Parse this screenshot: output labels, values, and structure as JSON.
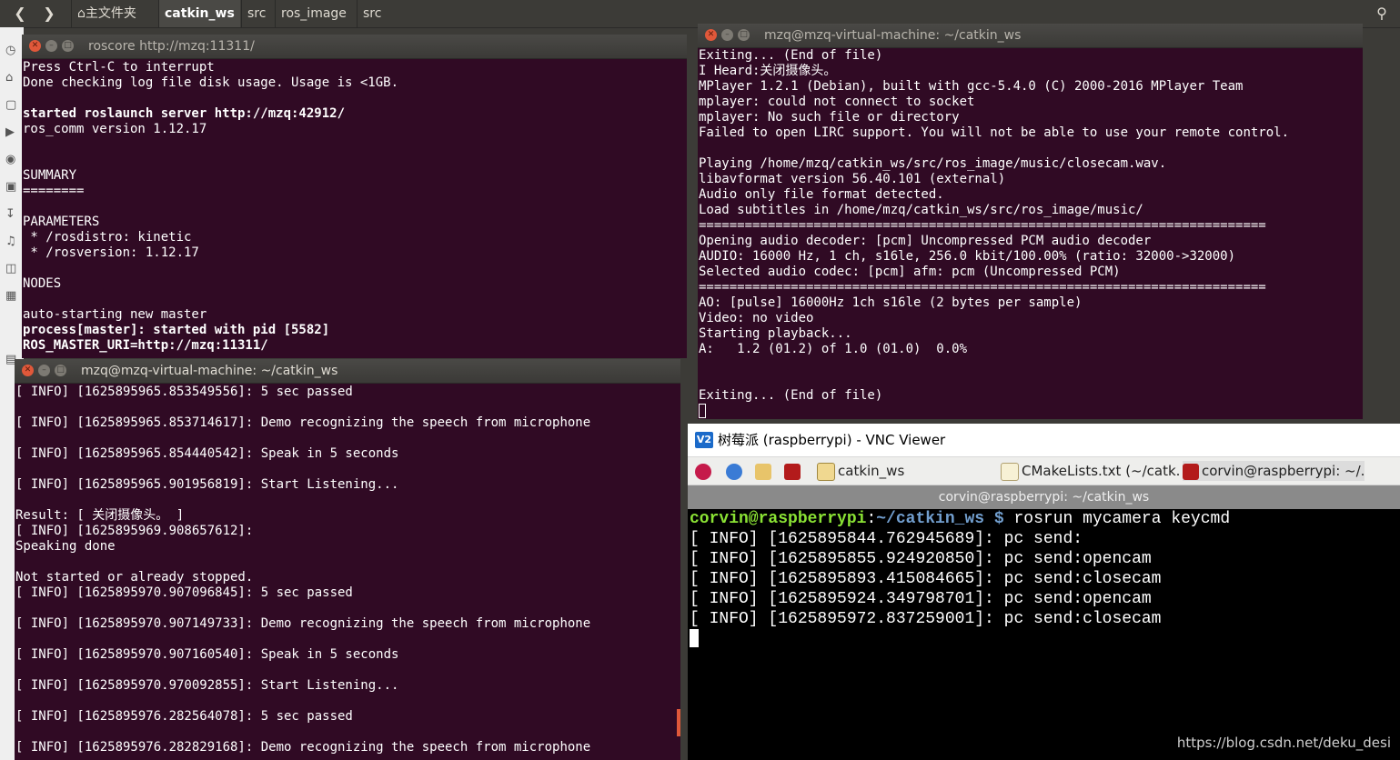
{
  "nautilus": {
    "home_label": "主文件夹",
    "path": [
      "catkin_ws",
      "src",
      "ros_image",
      "src"
    ]
  },
  "roscore": {
    "title": "roscore http://mzq:11311/",
    "lines": [
      {
        "text": "Press Ctrl-C to interrupt",
        "bold": false
      },
      {
        "text": "Done checking log file disk usage. Usage is <1GB.",
        "bold": false
      },
      {
        "text": "",
        "bold": false
      },
      {
        "text": "started roslaunch server http://mzq:42912/",
        "bold": true
      },
      {
        "text": "ros_comm version 1.12.17",
        "bold": false
      },
      {
        "text": "",
        "bold": false
      },
      {
        "text": "",
        "bold": false
      },
      {
        "text": "SUMMARY",
        "bold": false
      },
      {
        "text": "========",
        "bold": false
      },
      {
        "text": "",
        "bold": false
      },
      {
        "text": "PARAMETERS",
        "bold": false
      },
      {
        "text": " * /rosdistro: kinetic",
        "bold": false
      },
      {
        "text": " * /rosversion: 1.12.17",
        "bold": false
      },
      {
        "text": "",
        "bold": false
      },
      {
        "text": "NODES",
        "bold": false
      },
      {
        "text": "",
        "bold": false
      },
      {
        "text": "auto-starting new master",
        "bold": false
      },
      {
        "text": "process[master]: started with pid [5582]",
        "bold": true
      },
      {
        "text": "ROS_MASTER_URI=http://mzq:11311/",
        "bold": true
      }
    ]
  },
  "mplayer": {
    "title": "mzq@mzq-virtual-machine: ~/catkin_ws",
    "lines": [
      "Exiting... (End of file)",
      "I Heard:关闭摄像头。",
      "MPlayer 1.2.1 (Debian), built with gcc-5.4.0 (C) 2000-2016 MPlayer Team",
      "mplayer: could not connect to socket",
      "mplayer: No such file or directory",
      "Failed to open LIRC support. You will not be able to use your remote control.",
      "",
      "Playing /home/mzq/catkin_ws/src/ros_image/music/closecam.wav.",
      "libavformat version 56.40.101 (external)",
      "Audio only file format detected.",
      "Load subtitles in /home/mzq/catkin_ws/src/ros_image/music/",
      "==========================================================================",
      "Opening audio decoder: [pcm] Uncompressed PCM audio decoder",
      "AUDIO: 16000 Hz, 1 ch, s16le, 256.0 kbit/100.00% (ratio: 32000->32000)",
      "Selected audio codec: [pcm] afm: pcm (Uncompressed PCM)",
      "==========================================================================",
      "AO: [pulse] 16000Hz 1ch s16le (2 bytes per sample)",
      "Video: no video",
      "Starting playback...",
      "A:   1.2 (01.2) of 1.0 (01.0)  0.0%",
      "",
      "",
      "Exiting... (End of file)"
    ]
  },
  "speech": {
    "title": "mzq@mzq-virtual-machine: ~/catkin_ws",
    "lines": [
      "[ INFO] [1625895965.853549556]: 5 sec passed",
      "",
      "[ INFO] [1625895965.853714617]: Demo recognizing the speech from microphone",
      "",
      "[ INFO] [1625895965.854440542]: Speak in 5 seconds",
      "",
      "[ INFO] [1625895965.901956819]: Start Listening...",
      "",
      "Result: [ 关闭摄像头。 ]",
      "[ INFO] [1625895969.908657612]:",
      "Speaking done",
      "",
      "Not started or already stopped.",
      "[ INFO] [1625895970.907096845]: 5 sec passed",
      "",
      "[ INFO] [1625895970.907149733]: Demo recognizing the speech from microphone",
      "",
      "[ INFO] [1625895970.907160540]: Speak in 5 seconds",
      "",
      "[ INFO] [1625895970.970092855]: Start Listening...",
      "",
      "[ INFO] [1625895976.282564078]: 5 sec passed",
      "",
      "[ INFO] [1625895976.282829168]: Demo recognizing the speech from microphone"
    ]
  },
  "vnc": {
    "title": "树莓派 (raspberrypi) - VNC Viewer",
    "logo_text": "V2",
    "panel_items": [
      "catkin_ws",
      "CMakeLists.txt (~/catk...",
      "corvin@raspberrypi: ~/..."
    ],
    "window_title": "corvin@raspberrypi: ~/catkin_ws",
    "prompt_user": "corvin@raspberrypi",
    "prompt_sep": ":",
    "prompt_path": "~/catkin_ws $",
    "command": " rosrun mycamera keycmd",
    "lines": [
      "[ INFO] [1625895844.762945689]: pc send:",
      "[ INFO] [1625895855.924920850]: pc send:opencam",
      "[ INFO] [1625895893.415084665]: pc send:closecam",
      "[ INFO] [1625895924.349798701]: pc send:opencam",
      "[ INFO] [1625895972.837259001]: pc send:closecam"
    ]
  },
  "watermark": "https://blog.csdn.net/deku_desi",
  "colors": {
    "terminal_bg": "#300a24",
    "close_button": "#e0583a",
    "prompt_green": "#8ae234",
    "prompt_blue": "#729fcf"
  }
}
